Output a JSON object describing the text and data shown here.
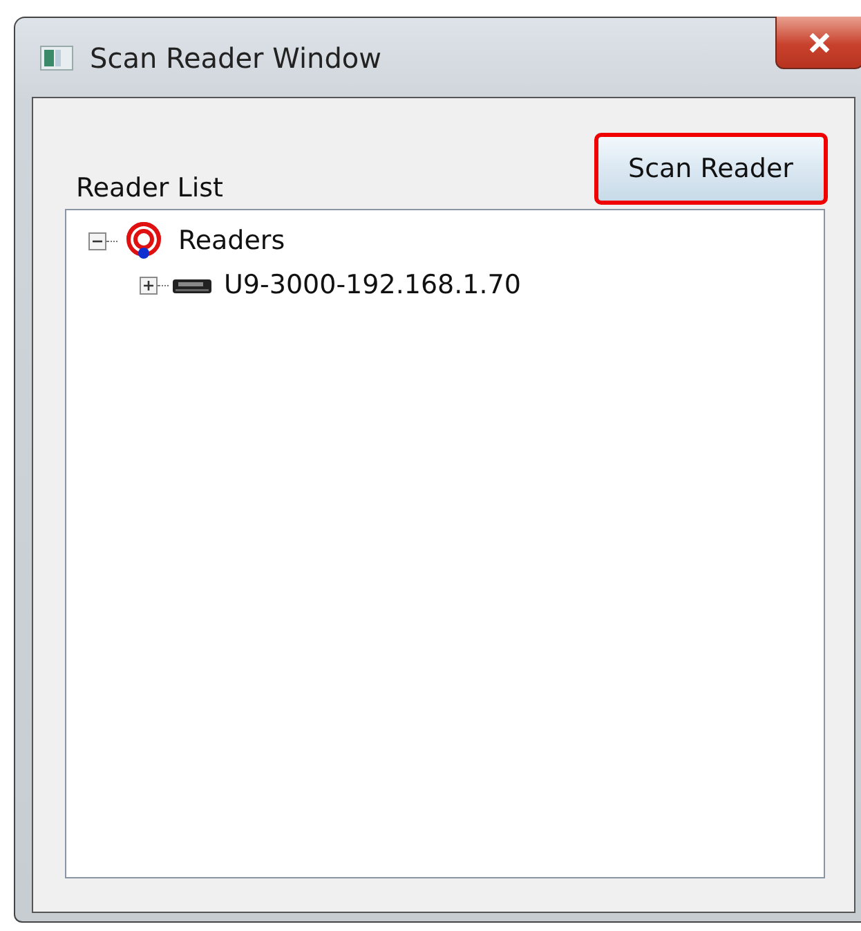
{
  "window": {
    "title": "Scan Reader Window"
  },
  "reader_list": {
    "label": "Reader List",
    "tree": [
      {
        "label": "Readers",
        "kind": "root",
        "expanded": true,
        "children": [
          {
            "label": "U9-3000-192.168.1.70",
            "kind": "reader",
            "expanded": false
          }
        ]
      }
    ]
  },
  "buttons": [
    {
      "label": "Scan Reader",
      "highlighted": true
    }
  ]
}
